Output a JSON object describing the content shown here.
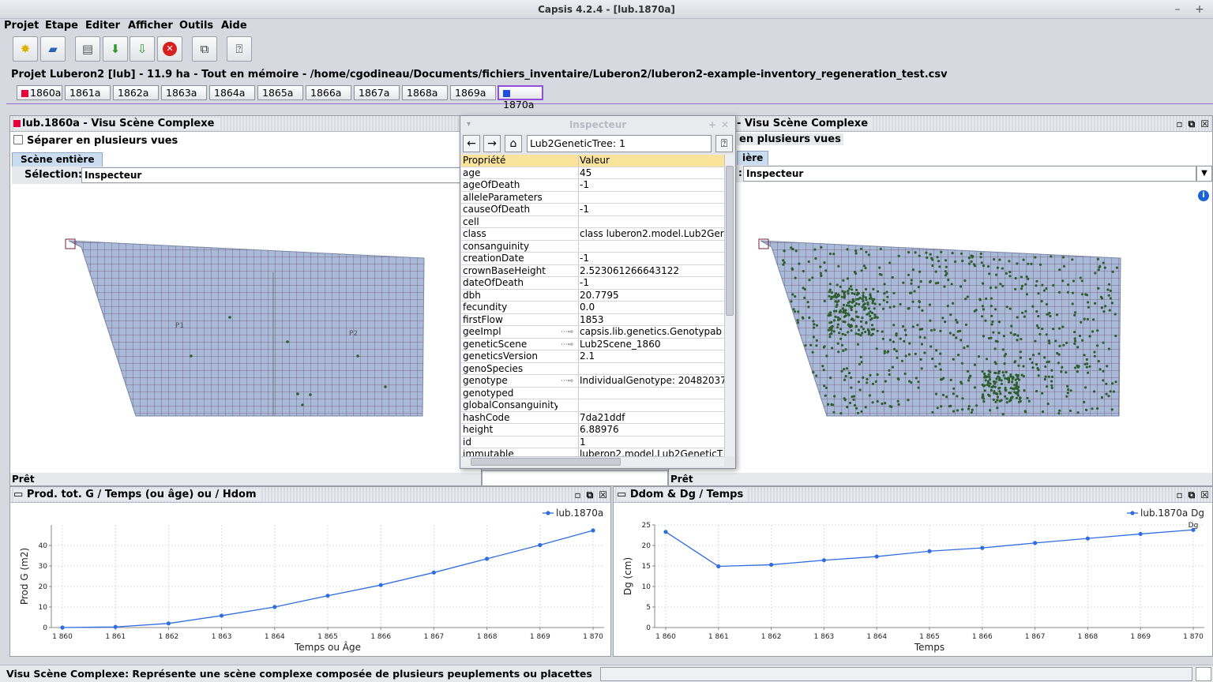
{
  "window": {
    "title": "Capsis 4.2.4 - [lub.1870a]"
  },
  "menu": [
    "Projet",
    "Etape",
    "Editer",
    "Afficher",
    "Outils",
    "Aide"
  ],
  "toolbar": {
    "buttons": [
      "new-project-icon",
      "open-project-icon",
      "open-file-icon",
      "import-icon",
      "export-icon",
      "close-icon",
      "compare-icon",
      "help-icon"
    ]
  },
  "project": {
    "title": "Projet Luberon2 [lub] - 11.9 ha - Tout en mémoire - /home/cgodineau/Documents/fichiers_inventaire/Luberon2/luberon2-example-inventory_regeneration_test.csv",
    "steps": [
      "1860a",
      "1861a",
      "1862a",
      "1863a",
      "1864a",
      "1865a",
      "1866a",
      "1867a",
      "1868a",
      "1869a",
      "1870a"
    ],
    "step_colors": {
      "first": "#e8003c",
      "last": "#1f4de0"
    }
  },
  "left_view": {
    "title": "lub.1860a - Visu Scène Complexe",
    "checkbox": "Séparer en plusieurs vues",
    "tab": "Scène entière",
    "selection_label": "Sélection:",
    "selection_value": "Inspecteur",
    "status": "Prêt",
    "plot_labels": [
      "P1",
      "P2"
    ]
  },
  "right_view": {
    "title": "- Visu Scène Complexe",
    "checkbox": "en plusieurs vues",
    "tab": "ière",
    "selection_label": ":",
    "selection_value": "Inspecteur",
    "status": "Prêt"
  },
  "inspector": {
    "title": "Inspecteur",
    "path": "Lub2GeneticTree: 1",
    "col_property": "Propriété",
    "col_value": "Valeur",
    "rows": [
      {
        "k": "age",
        "v": "45",
        "btn": false
      },
      {
        "k": "ageOfDeath",
        "v": "-1",
        "btn": false
      },
      {
        "k": "alleleParameters",
        "v": "",
        "btn": false
      },
      {
        "k": "causeOfDeath",
        "v": "-1",
        "btn": false
      },
      {
        "k": "cell",
        "v": "",
        "btn": false
      },
      {
        "k": "class",
        "v": "class luberon2.model.Lub2Ger",
        "btn": false
      },
      {
        "k": "consanguinity",
        "v": "",
        "btn": false
      },
      {
        "k": "creationDate",
        "v": "-1",
        "btn": false
      },
      {
        "k": "crownBaseHeight",
        "v": "2.523061266643122",
        "btn": false
      },
      {
        "k": "dateOfDeath",
        "v": "-1",
        "btn": false
      },
      {
        "k": "dbh",
        "v": "20.7795",
        "btn": false
      },
      {
        "k": "fecundity",
        "v": "0.0",
        "btn": false
      },
      {
        "k": "firstFlow",
        "v": "1853",
        "btn": false
      },
      {
        "k": "geeImpl",
        "v": "capsis.lib.genetics.Genotypab",
        "btn": true
      },
      {
        "k": "geneticScene",
        "v": "Lub2Scene_1860",
        "btn": true
      },
      {
        "k": "geneticsVersion",
        "v": "2.1",
        "btn": false
      },
      {
        "k": "genoSpecies",
        "v": "",
        "btn": false
      },
      {
        "k": "genotype",
        "v": "IndividualGenotype: 20482037",
        "btn": true
      },
      {
        "k": "genotyped",
        "v": "",
        "btn": false
      },
      {
        "k": "globalConsanguinity",
        "v": "",
        "btn": false
      },
      {
        "k": "hashCode",
        "v": "7da21ddf",
        "btn": false
      },
      {
        "k": "height",
        "v": "6.88976",
        "btn": false
      },
      {
        "k": "id",
        "v": "1",
        "btn": false
      },
      {
        "k": "immutable",
        "v": "luberon2.model.Lub2GeneticT",
        "btn": false
      }
    ]
  },
  "chart_left_title": "Prod. tot. G / Temps (ou âge) ou / Hdom",
  "chart_right_title": "Ddom & Dg / Temps",
  "chart_data": [
    {
      "type": "line",
      "title": "",
      "xlabel": "Temps ou Âge",
      "ylabel": "Prod G (m2)",
      "x": [
        1860,
        1861,
        1862,
        1863,
        1864,
        1865,
        1866,
        1867,
        1868,
        1869,
        1870
      ],
      "x_tick_labels": [
        "1 860",
        "1 861",
        "1 862",
        "1 863",
        "1 864",
        "1 865",
        "1 866",
        "1 867",
        "1 868",
        "1 869",
        "1 870"
      ],
      "series": [
        {
          "name": "lub.1870a",
          "color": "#2f6de1",
          "values": [
            0,
            0.3,
            2.0,
            5.8,
            10.0,
            15.5,
            20.7,
            26.8,
            33.5,
            40.2,
            47.3
          ]
        }
      ],
      "ylim": [
        0,
        50
      ],
      "yticks": [
        0,
        10,
        20,
        30,
        40
      ],
      "grid": true,
      "legend": "top-right"
    },
    {
      "type": "line",
      "title": "",
      "xlabel": "Temps",
      "ylabel": "Dg (cm)",
      "x": [
        1860,
        1861,
        1862,
        1863,
        1864,
        1865,
        1866,
        1867,
        1868,
        1869,
        1870
      ],
      "x_tick_labels": [
        "1 860",
        "1 861",
        "1 862",
        "1 863",
        "1 864",
        "1 865",
        "1 866",
        "1 867",
        "1 868",
        "1 869",
        "1 870"
      ],
      "series": [
        {
          "name": "lub.1870a Dg",
          "color": "#2f6de1",
          "values": [
            23.3,
            14.9,
            15.3,
            16.4,
            17.3,
            18.6,
            19.4,
            20.6,
            21.7,
            22.8,
            23.8
          ]
        }
      ],
      "point_label": "Dg",
      "ylim": [
        0,
        25
      ],
      "yticks": [
        0,
        5,
        10,
        15,
        20,
        25
      ],
      "grid": true,
      "legend": "top-right"
    }
  ],
  "footer": {
    "status": "Visu Scène Complexe: Représente une scène complexe composée de plusieurs peuplements ou placettes"
  }
}
